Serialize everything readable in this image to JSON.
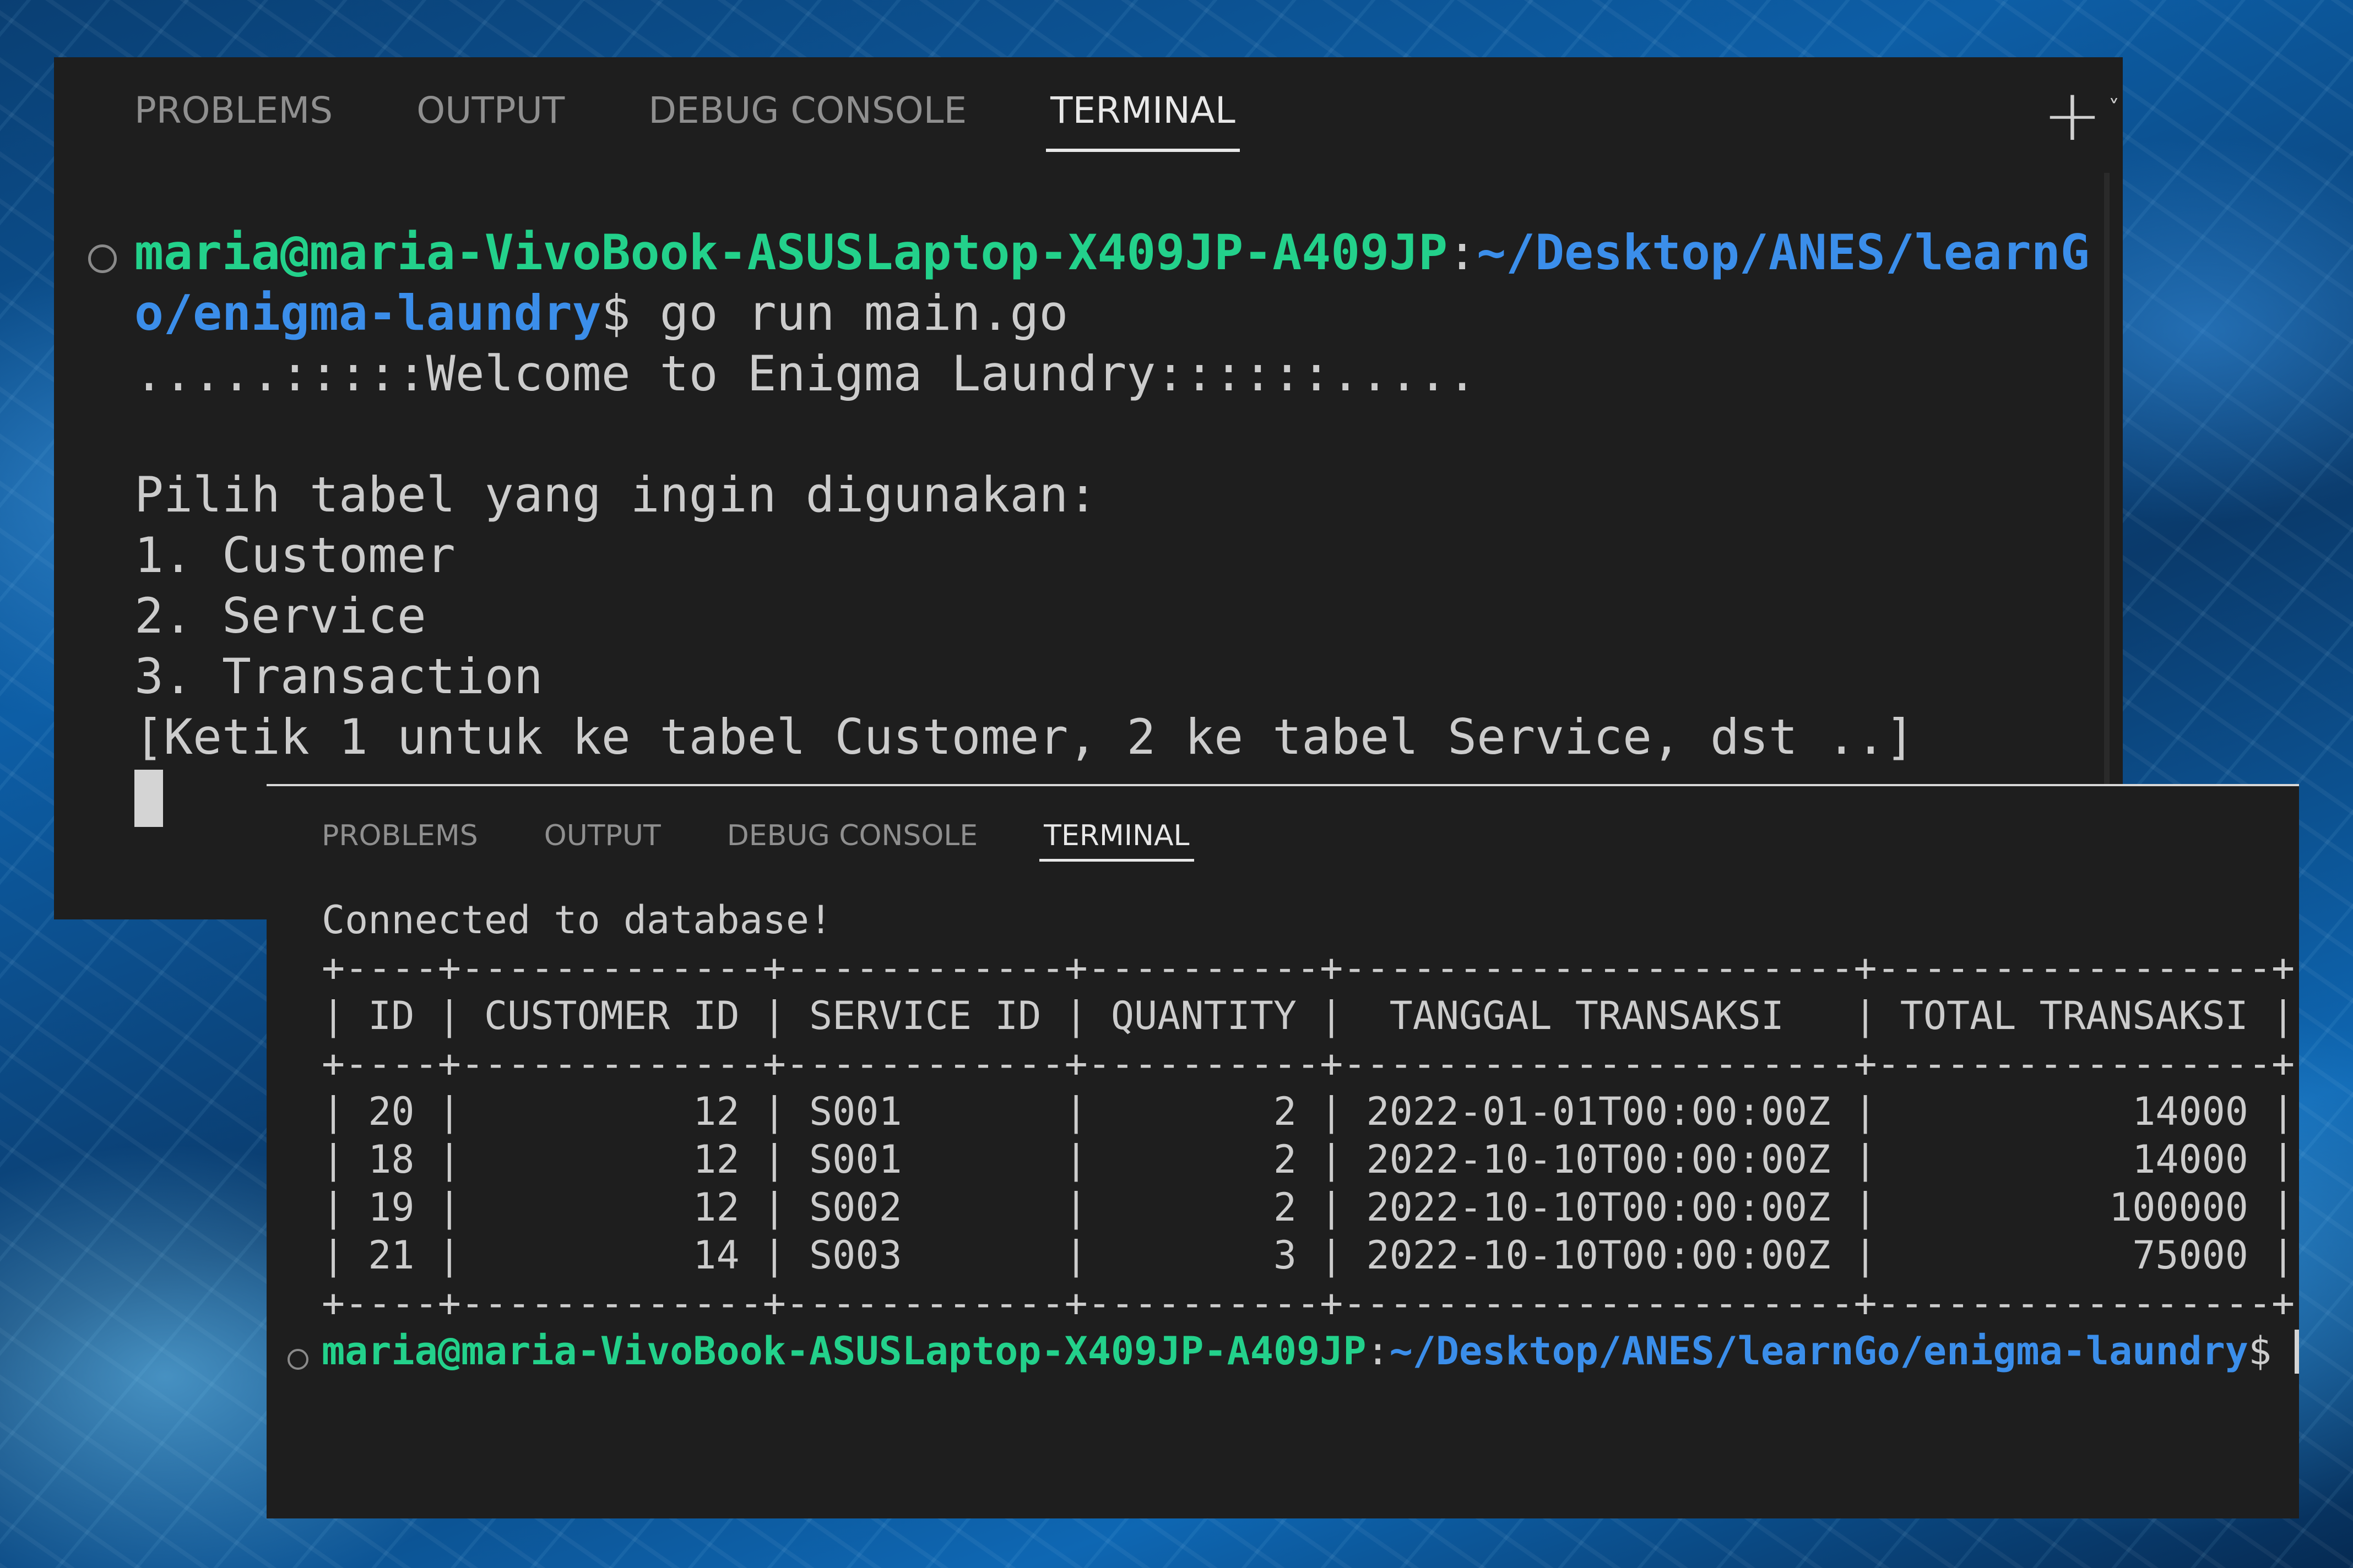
{
  "colors": {
    "panel_bg": "#1e1e1e",
    "prompt_user": "#23d18b",
    "prompt_path": "#3b8eea",
    "text": "#cccccc",
    "tab_inactive": "#8f8f8f",
    "tab_active": "#e8e8e8"
  },
  "panel1": {
    "tabs": [
      {
        "label": "PROBLEMS"
      },
      {
        "label": "OUTPUT"
      },
      {
        "label": "DEBUG CONSOLE"
      },
      {
        "label": "TERMINAL"
      }
    ],
    "add_icon": "plus-icon",
    "dropdown_icon": "chevron-down-icon",
    "prompt": {
      "user_line1": "maria@maria-VivoBook-ASUSLaptop-X409JP-A409JP",
      "colon": ":",
      "path_line1": "~/Desktop/ANES/learnG",
      "path_line2": "o/enigma-laundry",
      "dollar_cmd": "$ go run main.go"
    },
    "output": [
      ".....:::::Welcome to Enigma Laundry::::::.....",
      "",
      "Pilih tabel yang ingin digunakan:",
      "1. Customer",
      "2. Service",
      "3. Transaction",
      "[Ketik 1 untuk ke tabel Customer, 2 ke tabel Service, dst ..]"
    ]
  },
  "panel2": {
    "tabs": [
      {
        "label": "PROBLEMS"
      },
      {
        "label": "OUTPUT"
      },
      {
        "label": "DEBUG CONSOLE"
      },
      {
        "label": "TERMINAL"
      }
    ],
    "lines": [
      "Connected to database!",
      "+----+-------------+------------+----------+----------------------+-----------------+",
      "| ID | CUSTOMER ID | SERVICE ID | QUANTITY |  TANGGAL TRANSAKSI   | TOTAL TRANSAKSI |",
      "+----+-------------+------------+----------+----------------------+-----------------+",
      "| 20 |          12 | S001       |        2 | 2022-01-01T00:00:00Z |           14000 |",
      "| 18 |          12 | S001       |        2 | 2022-10-10T00:00:00Z |           14000 |",
      "| 19 |          12 | S002       |        2 | 2022-10-10T00:00:00Z |          100000 |",
      "| 21 |          14 | S003       |        3 | 2022-10-10T00:00:00Z |           75000 |",
      "+----+-------------+------------+----------+----------------------+-----------------+"
    ],
    "prompt": {
      "user": "maria@maria-VivoBook-ASUSLaptop-X409JP-A409JP",
      "colon": ":",
      "path": "~/Desktop/ANES/learnGo/enigma-laundry",
      "dollar": "$ "
    }
  }
}
